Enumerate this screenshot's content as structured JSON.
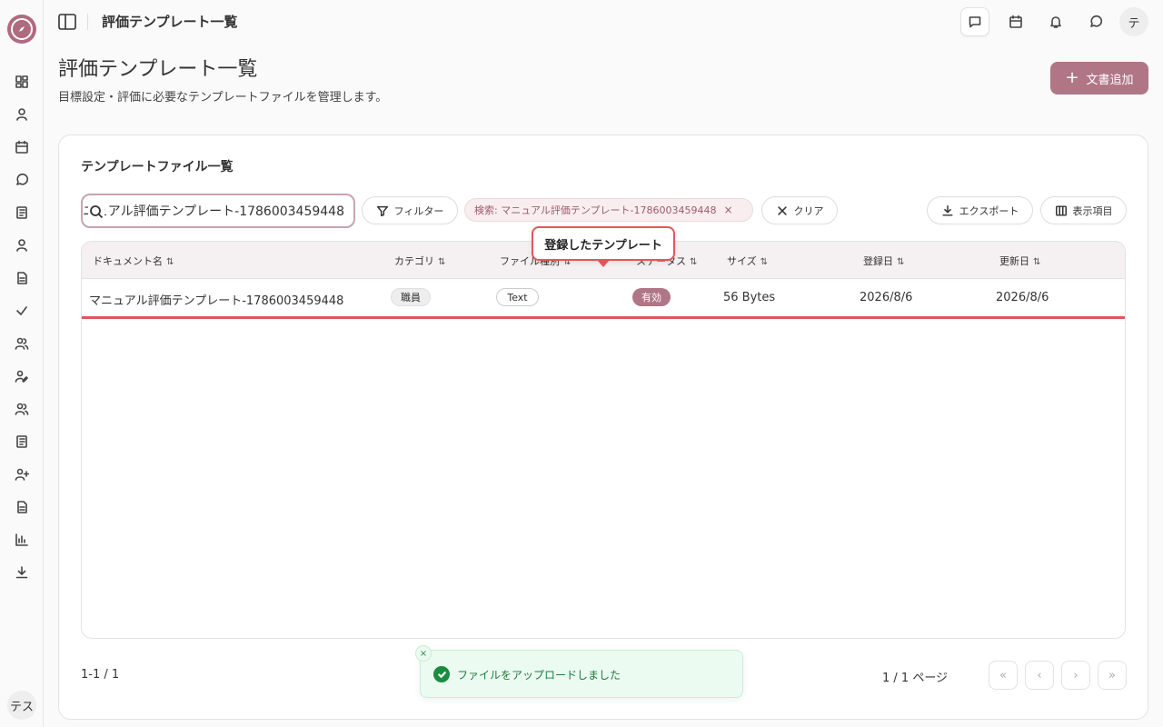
{
  "topbar": {
    "title": "評価テンプレート一覧",
    "avatar": "テ"
  },
  "sidebar": {
    "avatar": "テス"
  },
  "header": {
    "title": "評価テンプレート一覧",
    "subtitle": "目標設定・評価に必要なテンプレートファイルを管理します。",
    "add_label": "文書追加"
  },
  "card": {
    "title": "テンプレートファイル一覧"
  },
  "toolbar": {
    "search_value": "マニュアル評価テンプレート-1786003459448",
    "filter_label": "フィルター",
    "chip_label": "検索: マニュアル評価テンプレート-1786003459448",
    "chip_close": "×",
    "clear_label": "クリア",
    "export_label": "エクスポート",
    "columns_label": "表示項目"
  },
  "table": {
    "sort_glyph": "⇅",
    "headers": {
      "name": "ドキュメント名",
      "category": "カテゴリ",
      "filetype": "ファイル種別",
      "status": "ステータス",
      "size": "サイズ",
      "registered": "登録日",
      "updated": "更新日"
    },
    "rows": [
      {
        "name": "マニュアル評価テンプレート-1786003459448",
        "category": "職員",
        "filetype": "Text",
        "status": "有効",
        "size": "56 Bytes",
        "registered": "2026/8/6",
        "updated": "2026/8/6"
      }
    ]
  },
  "tooltip": {
    "text": "登録したテンプレート"
  },
  "footer": {
    "count": "1-1 / 1",
    "page_info": "1 / 1 ページ",
    "first": "«",
    "prev": "‹",
    "next": "›",
    "last": "»"
  },
  "toast": {
    "message": "ファイルをアップロードしました",
    "close": "×"
  },
  "colors": {
    "accent": "#b07686",
    "highlight": "#e0575a",
    "success": "#1a8c3e"
  }
}
